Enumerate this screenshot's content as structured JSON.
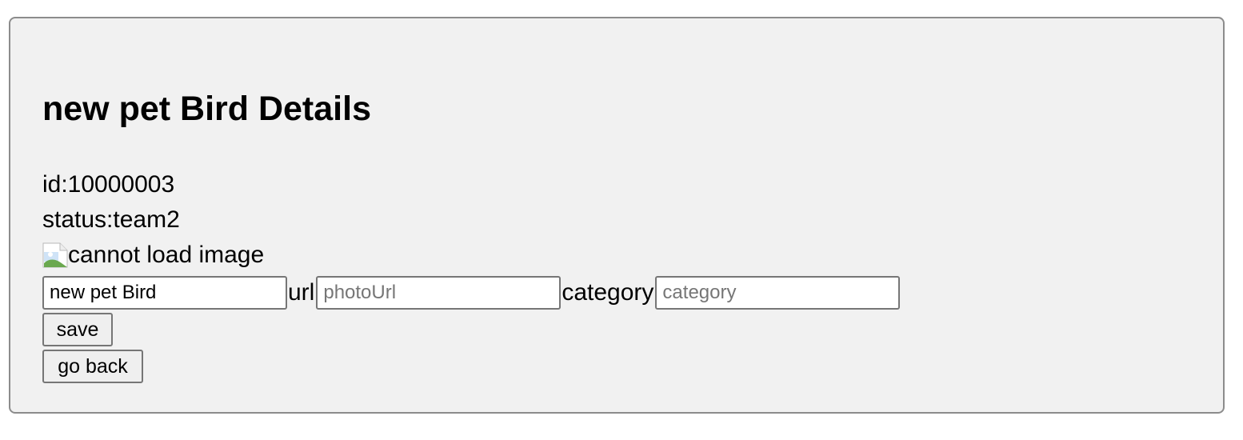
{
  "pet": {
    "title": "new pet Bird Details",
    "id_text": "id:10000003",
    "status_text": "status:team2",
    "image_alt": "cannot load image"
  },
  "form": {
    "name_value": "new pet Bird",
    "url_label": "url",
    "url_placeholder": "photoUrl",
    "category_label": "category",
    "category_placeholder": "category"
  },
  "buttons": {
    "save_label": "save",
    "back_label": "go back"
  },
  "icons": {
    "broken_image": "broken-image-icon"
  }
}
